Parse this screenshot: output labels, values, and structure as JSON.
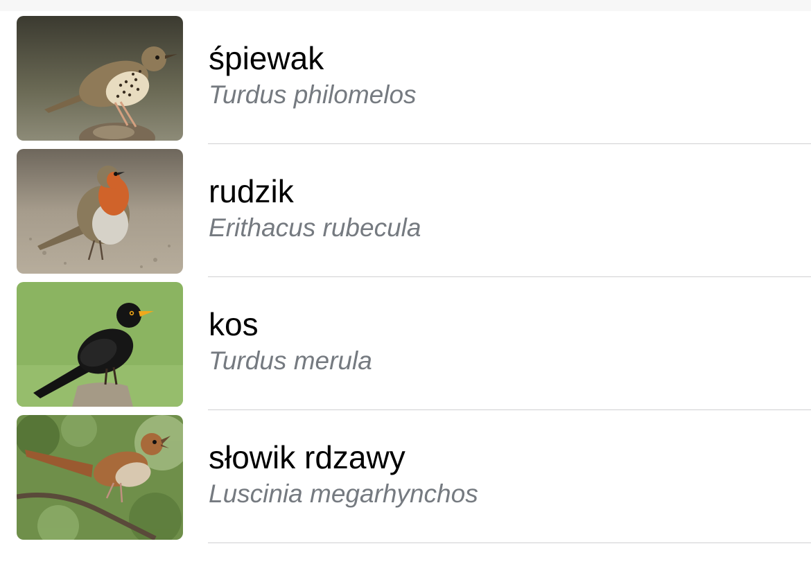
{
  "birds": [
    {
      "common_name": "śpiewak",
      "latin_name": "Turdus philomelos",
      "image": "song-thrush-photo"
    },
    {
      "common_name": "rudzik",
      "latin_name": "Erithacus rubecula",
      "image": "robin-photo"
    },
    {
      "common_name": "kos",
      "latin_name": "Turdus merula",
      "image": "blackbird-photo"
    },
    {
      "common_name": "słowik rdzawy",
      "latin_name": "Luscinia megarhynchos",
      "image": "nightingale-photo"
    }
  ],
  "colors": {
    "separator": "#cfcfd2",
    "latin_text": "#757a80",
    "common_text": "#000000"
  }
}
